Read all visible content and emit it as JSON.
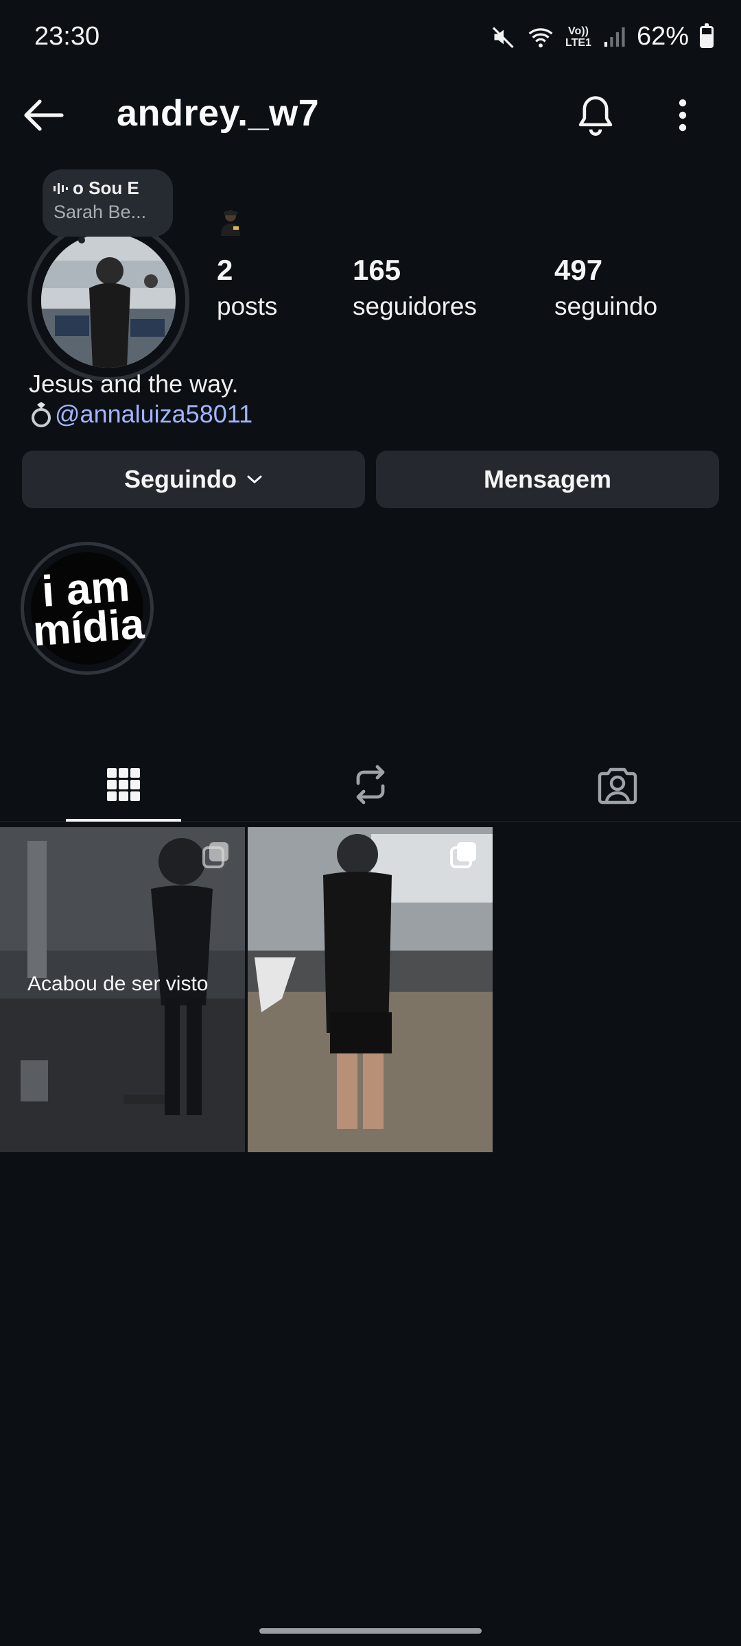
{
  "status_bar": {
    "time": "23:30",
    "lte_top": "Vo))",
    "lte_bottom": "LTE1",
    "battery_percent": "62%",
    "battery_level": 0.62
  },
  "header": {
    "username": "andrey._w7"
  },
  "music": {
    "title": "o Sou E",
    "artist": "Sarah Be..."
  },
  "stats": {
    "posts_count": "2",
    "posts_label": "posts",
    "followers_count": "165",
    "followers_label": "seguidores",
    "following_count": "497",
    "following_label": "seguindo"
  },
  "bio": {
    "line1": "Jesus and the way.",
    "mention": "@annaluiza58011"
  },
  "buttons": {
    "following": "Seguindo",
    "message": "Mensagem"
  },
  "highlight": {
    "line1": "i am",
    "line2": "mídia"
  },
  "posts": [
    {
      "overlay": "Acabou de ser visto"
    },
    {
      "overlay": ""
    }
  ],
  "icons": {
    "back": "back-arrow-icon",
    "bell": "bell-icon",
    "more": "more-vertical-icon",
    "grid": "grid-icon",
    "reels": "repost-icon",
    "tagged": "tagged-person-icon",
    "mute": "mute-icon",
    "wifi": "wifi-icon",
    "signal": "signal-icon",
    "battery": "battery-icon",
    "multi": "multi-photo-icon",
    "ring": "ring-icon",
    "music": "music-bars-icon"
  }
}
